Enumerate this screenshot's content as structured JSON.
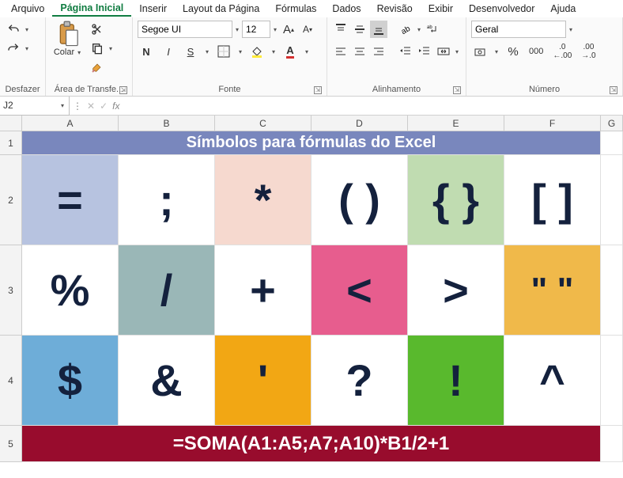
{
  "menu": {
    "items": [
      "Arquivo",
      "Página Inicial",
      "Inserir",
      "Layout da Página",
      "Fórmulas",
      "Dados",
      "Revisão",
      "Exibir",
      "Desenvolvedor",
      "Ajuda"
    ],
    "active_index": 1
  },
  "ribbon": {
    "undo_label": "Desfazer",
    "clipboard_label": "Área de Transfe...",
    "paste_label": "Colar",
    "font_label": "Fonte",
    "font_name": "Segoe UI",
    "font_size": "12",
    "align_label": "Alinhamento",
    "number_label": "Número",
    "number_format": "Geral"
  },
  "name_box": "J2",
  "formula_bar_value": "",
  "columns": [
    "A",
    "B",
    "C",
    "D",
    "E",
    "F",
    "G"
  ],
  "rows": [
    "1",
    "2",
    "3",
    "4",
    "5"
  ],
  "sheet": {
    "title": "Símbolos para fórmulas do Excel",
    "r2": [
      {
        "text": "=",
        "bg": "#b7c3e0"
      },
      {
        "text": ";",
        "bg": "#ffffff"
      },
      {
        "text": "*",
        "bg": "#f6d9cf"
      },
      {
        "text": "( )",
        "bg": "#ffffff"
      },
      {
        "text": "{ }",
        "bg": "#c0dcb1"
      },
      {
        "text": "[ ]",
        "bg": "#ffffff"
      }
    ],
    "r3": [
      {
        "text": "%",
        "bg": "#ffffff"
      },
      {
        "text": "/",
        "bg": "#9ab7b7"
      },
      {
        "text": "+",
        "bg": "#ffffff"
      },
      {
        "text": "<",
        "bg": "#e75d8e"
      },
      {
        "text": ">",
        "bg": "#ffffff"
      },
      {
        "text": "\"  \"",
        "bg": "#f0b94a"
      }
    ],
    "r4": [
      {
        "text": "$",
        "bg": "#6eadd8"
      },
      {
        "text": "&",
        "bg": "#ffffff"
      },
      {
        "text": "'",
        "bg": "#f2a714"
      },
      {
        "text": "?",
        "bg": "#ffffff"
      },
      {
        "text": "!",
        "bg": "#59b92d"
      },
      {
        "text": "^",
        "bg": "#ffffff"
      }
    ],
    "formula_row": "=SOMA(A1:A5;A7;A10)*B1/2+1"
  }
}
